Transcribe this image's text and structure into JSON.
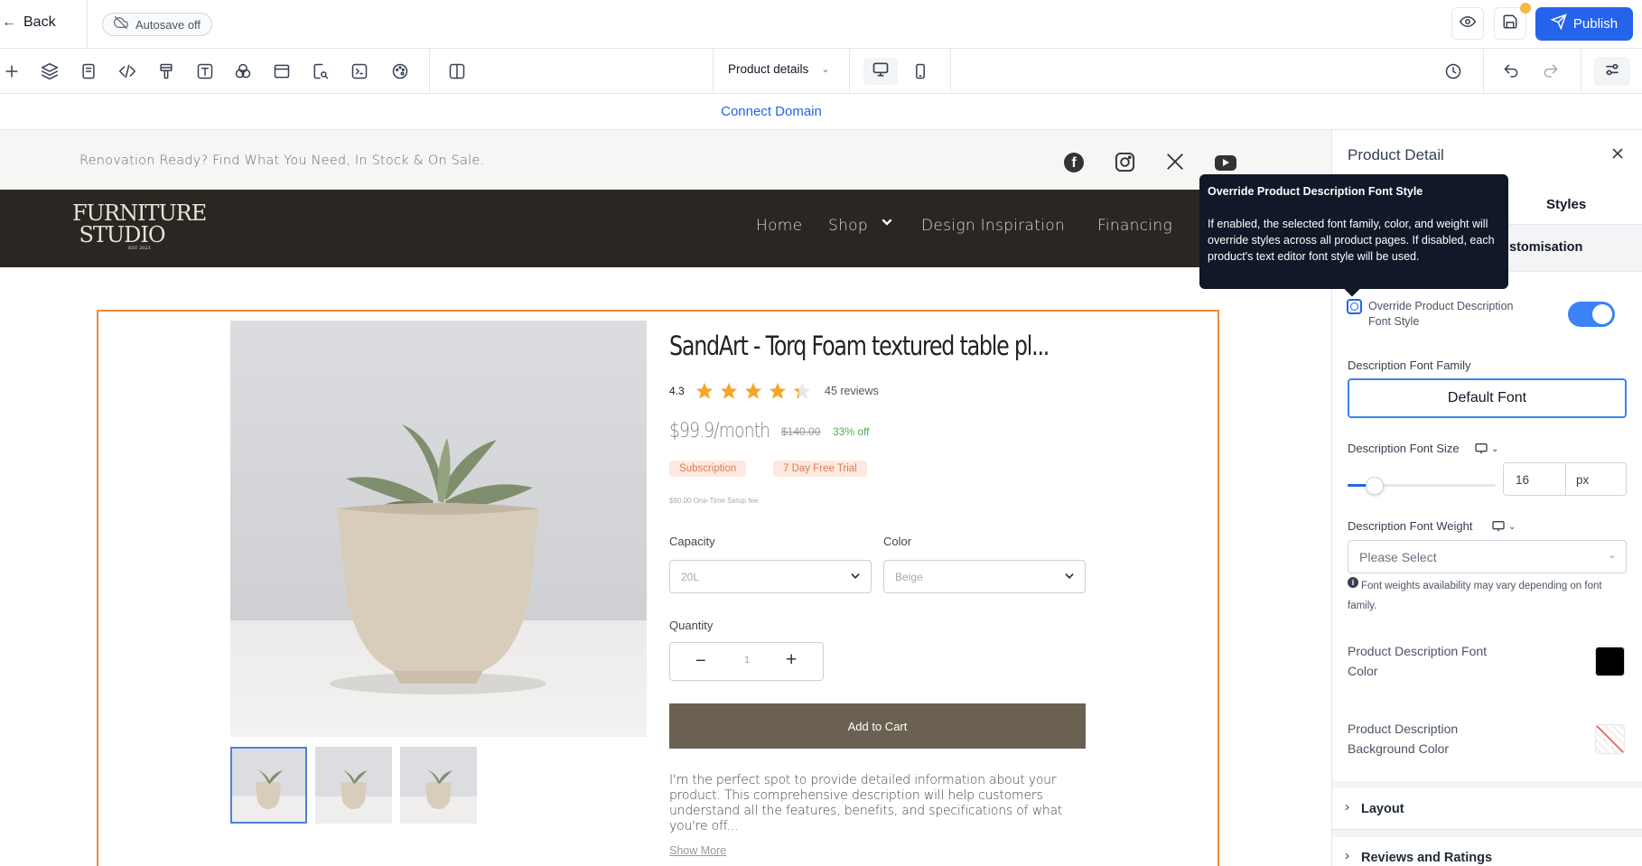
{
  "topbar": {
    "back_label": "Back",
    "autosave_label": "Autosave off",
    "publish_label": "Publish"
  },
  "toolbar": {
    "page_select": "Product details"
  },
  "connect_domain": "Connect Domain",
  "site": {
    "announcement": "Renovation Ready? Find What You Need, In Stock & On Sale.",
    "logo_line1": "FURNITURE",
    "logo_line2": "STUDIO",
    "logo_est": "EST 2023",
    "nav": [
      "Home",
      "Shop",
      "Design Inspiration",
      "Financing"
    ]
  },
  "product": {
    "title": "SandArt - Torq Foam textured table pl...",
    "rating": "4.3",
    "rating_value": 4.3,
    "reviews": "45 reviews",
    "price": "$99.9/month",
    "old_price": "$140.00",
    "discount": "33% off",
    "tags": [
      "Subscription",
      "7 Day Free Trial"
    ],
    "setup_fee": "$90.00 One-Time Setup fee",
    "capacity_label": "Capacity",
    "capacity_value": "20L",
    "color_label": "Color",
    "color_value": "Beige",
    "quantity_label": "Quantity",
    "quantity_value": "1",
    "add_to_cart": "Add to Cart",
    "description": "I'm the perfect spot to provide detailed information about your product. This comprehensive description will help customers understand all the features, benefits, and specifications of what you're off...",
    "show_more": "Show More"
  },
  "panel": {
    "title": "Product Detail",
    "tab_styles": "Styles",
    "section_customisation": "stomisation",
    "override_label": "Override Product Description Font Style",
    "font_family_label": "Description Font Family",
    "font_family_value": "Default Font",
    "font_size_label": "Description Font Size",
    "font_size_value": "16",
    "font_size_unit": "px",
    "font_weight_label": "Description Font Weight",
    "font_weight_placeholder": "Please Select",
    "font_weight_note": "Font weights availability may vary depending on font family.",
    "font_color_label": "Product Description Font Color",
    "bg_color_label": "Product Description Background Color",
    "layout_label": "Layout",
    "reviews_label": "Reviews and Ratings"
  },
  "tooltip": {
    "title": "Override Product Description Font Style",
    "body": "If enabled, the selected font family, color, and weight will override styles across all product pages. If disabled, each product's text editor font style will be used."
  },
  "colors": {
    "accent": "#2563eb",
    "nav_bg": "#2a2622",
    "cart_bg": "#6b6152",
    "frame": "#f08a3c",
    "star": "#f4a62a"
  }
}
